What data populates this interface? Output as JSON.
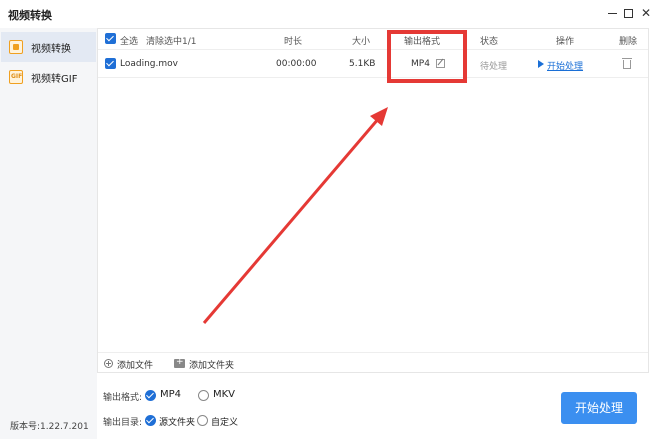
{
  "window": {
    "title": "视频转换",
    "minimize": "—",
    "maximize": "□",
    "close": "✕"
  },
  "sidebar": {
    "items": [
      {
        "label": "视频转换",
        "icon": "video-convert-icon",
        "active": true
      },
      {
        "label": "视频转GIF",
        "icon": "gif-icon",
        "active": false
      }
    ],
    "version": "版本号:1.22.7.201"
  },
  "table": {
    "select_all": "全选",
    "clear_selected": "清除选中1/1",
    "columns": {
      "duration": "时长",
      "size": "大小",
      "output_format": "输出格式",
      "status": "状态",
      "action": "操作",
      "delete": "删除"
    },
    "rows": [
      {
        "checked": true,
        "name": "Loading.mov",
        "duration": "00:00:00",
        "size": "5.1KB",
        "format": "MP4",
        "status": "待处理",
        "action": "开始处理"
      }
    ]
  },
  "footer": {
    "add_file": "添加文件",
    "add_folder": "添加文件夹"
  },
  "options": {
    "format_label": "输出格式:",
    "format_options": [
      {
        "label": "MP4",
        "selected": true
      },
      {
        "label": "MKV",
        "selected": false
      }
    ],
    "dir_label": "输出目录:",
    "dir_options": [
      {
        "label": "源文件夹",
        "selected": true
      },
      {
        "label": "自定义",
        "selected": false
      }
    ]
  },
  "start_button": "开始处理",
  "colors": {
    "accent": "#1f6fd6",
    "annotation": "#e53935",
    "button": "#3b8ff0"
  }
}
